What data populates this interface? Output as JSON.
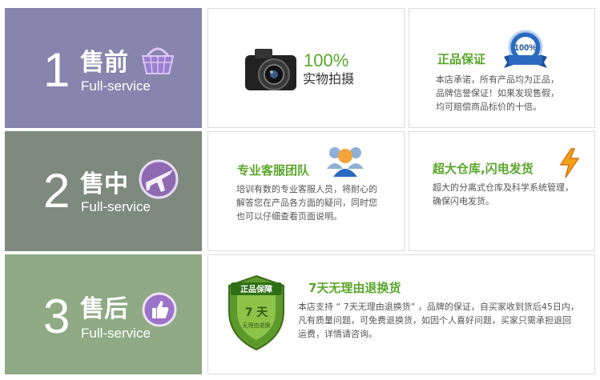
{
  "colors": {
    "presale_bg": "#8785ae",
    "insale_bg": "#7f8a7f",
    "aftersale_bg": "#8faa84",
    "accent_green": "#5aa62a"
  },
  "rows": [
    {
      "number": "1",
      "stage": "售前",
      "subtitle": "Full-service",
      "icon": "basket-icon"
    },
    {
      "number": "2",
      "stage": "售中",
      "subtitle": "Full-service",
      "icon": "airplane-globe-icon"
    },
    {
      "number": "3",
      "stage": "售后",
      "subtitle": "Full-service",
      "icon": "thumbs-up-icon"
    }
  ],
  "cards": {
    "real_photo": {
      "percent": "100%",
      "text": "实物拍摄",
      "icon": "camera-icon"
    },
    "authentic": {
      "title": "正品保证",
      "lines": [
        "本店承诺，所有产品均为正品，",
        "品牌信誉保证！如果发现售假，",
        "均可赔偿商品标价的十倍。"
      ],
      "badge_text": "100%",
      "icon": "authentic-seal-icon"
    },
    "service_team": {
      "title": "专业客服团队",
      "lines": [
        "培训有数的专业客服人员，将耐心的",
        "解答您在产品各方面的疑问，同时您",
        "也可以仔细查看页面说明。"
      ],
      "icon": "people-icon"
    },
    "warehouse": {
      "title": "超大仓库,闪电发货",
      "lines": [
        "超大的分离式仓库及科学系统管理，",
        "确保闪电发货。"
      ],
      "icon": "lightning-icon"
    },
    "return_policy": {
      "title": "7天无理由退换货",
      "lines": [
        "本店支持 “ 7天无理由退换货” ，品牌的保证，自买家收到货后45日内，",
        "凡有质量问题，可免费退换货，如因个人喜好问题，买家只需承担退回",
        "运费，详情请咨询。"
      ],
      "shield_top": "正品保障",
      "shield_mid": "7 天",
      "shield_bottom": "无理由退换",
      "icon": "shield-icon"
    }
  }
}
